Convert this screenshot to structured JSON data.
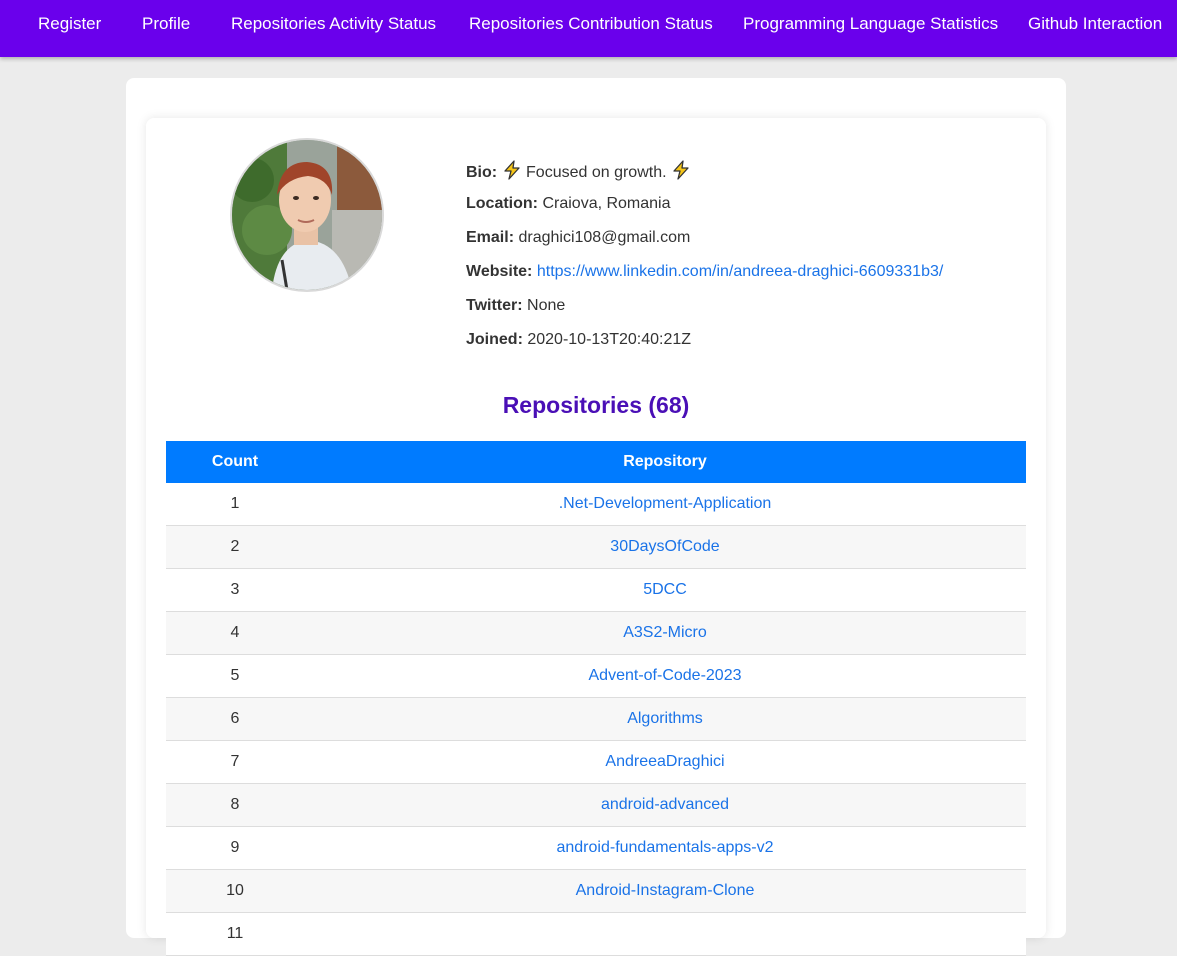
{
  "nav": {
    "items": [
      {
        "label": "Register"
      },
      {
        "label": "Profile"
      },
      {
        "label": "Repositories Activity Status"
      },
      {
        "label": "Repositories Contribution Status"
      },
      {
        "label": "Programming Language Statistics"
      },
      {
        "label": "Github Interaction"
      }
    ]
  },
  "profile": {
    "bio_label": "Bio:",
    "bio_value": "Focused on growth.",
    "location_label": "Location:",
    "location_value": "Craiova, Romania",
    "email_label": "Email:",
    "email_value": "draghici108@gmail.com",
    "website_label": "Website:",
    "website_value": "https://www.linkedin.com/in/andreea-draghici-6609331b3/",
    "twitter_label": "Twitter:",
    "twitter_value": "None",
    "joined_label": "Joined:",
    "joined_value": "2020-10-13T20:40:21Z"
  },
  "repositories": {
    "title": "Repositories (68)",
    "columns": [
      "Count",
      "Repository"
    ],
    "rows": [
      {
        "count": "1",
        "name": ".Net-Development-Application"
      },
      {
        "count": "2",
        "name": "30DaysOfCode"
      },
      {
        "count": "3",
        "name": "5DCC"
      },
      {
        "count": "4",
        "name": "A3S2-Micro"
      },
      {
        "count": "5",
        "name": "Advent-of-Code-2023"
      },
      {
        "count": "6",
        "name": "Algorithms"
      },
      {
        "count": "7",
        "name": "AndreeaDraghici"
      },
      {
        "count": "8",
        "name": "android-advanced"
      },
      {
        "count": "9",
        "name": "android-fundamentals-apps-v2"
      },
      {
        "count": "10",
        "name": "Android-Instagram-Clone"
      },
      {
        "count": "11",
        "name": ""
      }
    ]
  },
  "colors": {
    "navbar": "#6a00ec",
    "table_header": "#007bff",
    "title": "#4a0fb6",
    "link": "#1a73e8"
  }
}
